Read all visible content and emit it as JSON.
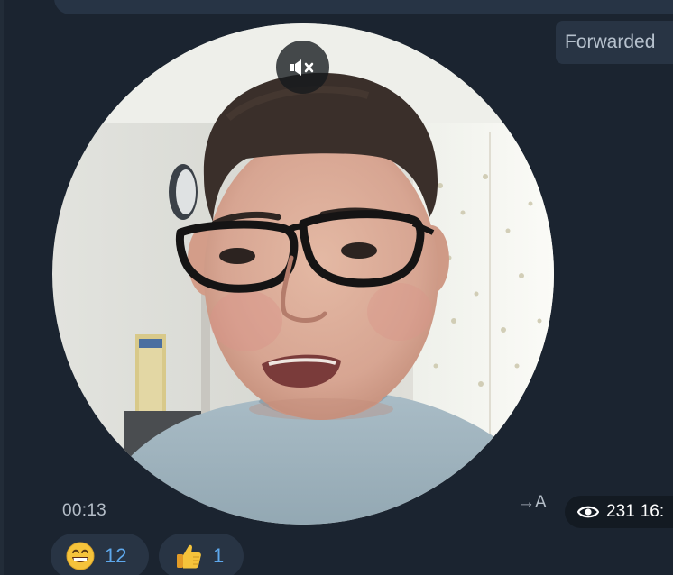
{
  "header": {
    "forwarded_label": "Forwarded"
  },
  "video_message": {
    "duration": "00:13",
    "muted": true,
    "mute_icon": "speaker-muted-icon"
  },
  "meta": {
    "translate_label": "→A",
    "views": "231",
    "time": "16:"
  },
  "reactions": [
    {
      "emoji": "grinning-face-with-smiling-eyes",
      "count": "12"
    },
    {
      "emoji": "thumbs-up",
      "count": "1"
    }
  ],
  "colors": {
    "background": "#1b2430",
    "bubble": "#283444",
    "reaction_count": "#5ea8ec",
    "meta_pill": "#131a22"
  }
}
